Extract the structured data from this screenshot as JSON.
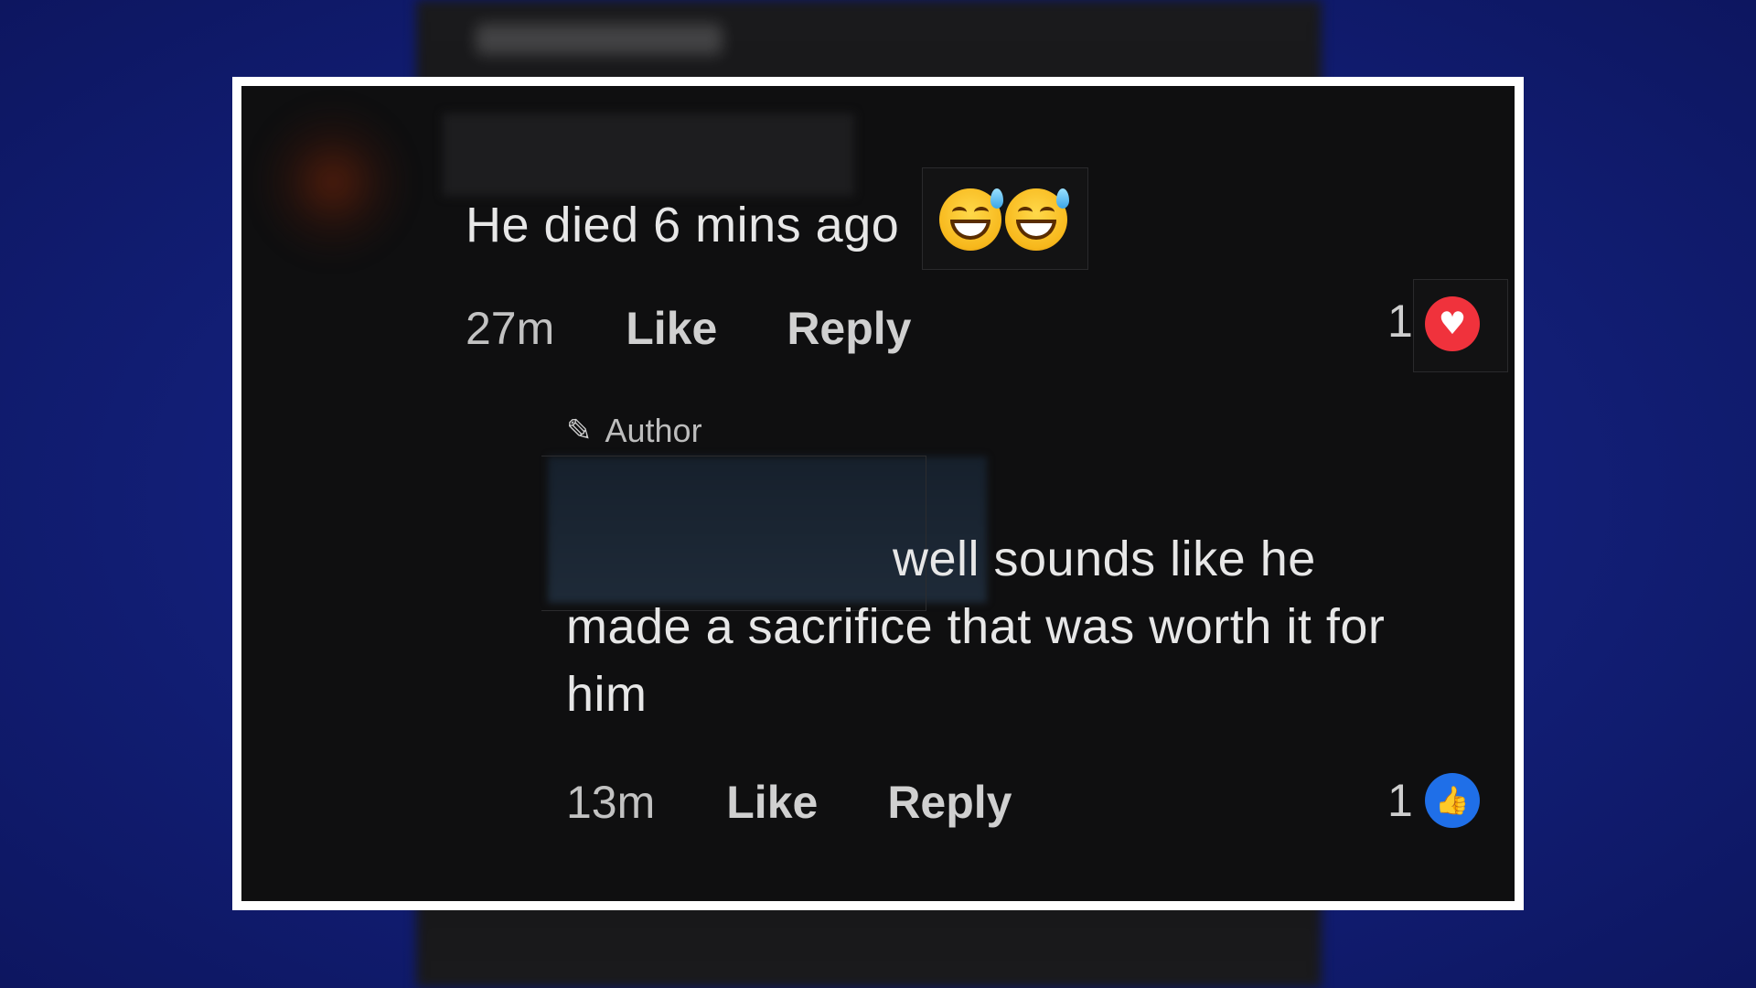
{
  "comment": {
    "text": "He died 6 mins ago",
    "emojis": [
      "grinning-face-with-sweat",
      "grinning-face-with-sweat"
    ],
    "time": "27m",
    "like_label": "Like",
    "reply_label": "Reply",
    "reaction_count": "1",
    "reaction_type": "heart-icon"
  },
  "reply": {
    "badge": "Author",
    "text_line1": "well sounds like he",
    "text_rest": "made a sacrifice that was worth it for him",
    "time": "13m",
    "like_label": "Like",
    "reply_label": "Reply",
    "reaction_count": "1",
    "reaction_type": "thumbs-up-icon"
  },
  "colors": {
    "background": "#13207a",
    "panel": "#0f0f10",
    "frame": "#ffffff",
    "heart": "#f0323c",
    "like": "#1f6fe8"
  }
}
